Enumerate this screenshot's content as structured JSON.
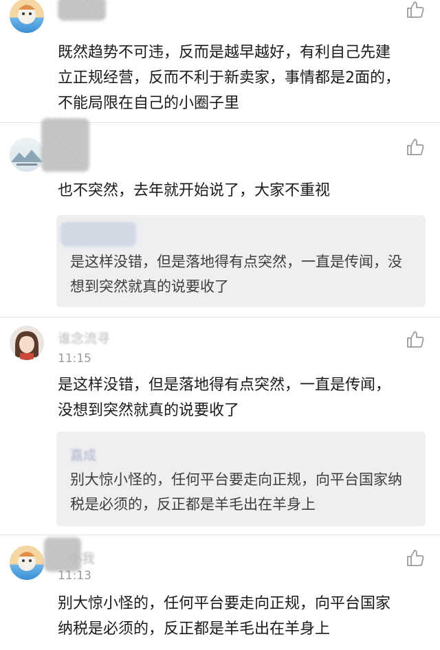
{
  "comments": [
    {
      "content": "既然趋势不可违，反而是越早越好，有利自己先建立正规经营，反而不利于新卖家，事情都是2面的，不能局限在自己的小圈子里"
    },
    {
      "content": "也不突然，去年就开始说了，大家不重视",
      "reply": {
        "text": "是这样没错，但是落地得有点突然，一直是传闻，没想到突然就真的说要收了"
      }
    },
    {
      "nickname": "谁念流寻",
      "time": "11:15",
      "content": "是这样没错，但是落地得有点突然，一直是传闻，没想到突然就真的说要收了",
      "reply": {
        "name": "嘉成",
        "text": "别大惊小怪的，任何平台要走向正规，向平台国家纳税是必须的，反正都是羊毛出在羊身上"
      }
    },
    {
      "nickname": "小我",
      "time": "11:13",
      "content": "别大惊小怪的，任何平台要走向正规，向平台国家纳税是必须的，反正都是羊毛出在羊身上"
    }
  ],
  "icons": {
    "like": "thumbs-up-icon"
  },
  "colors": {
    "reply_bg": "#efeff1",
    "reply_name": "#a9b3c8",
    "divider": "#e4e4e4"
  }
}
